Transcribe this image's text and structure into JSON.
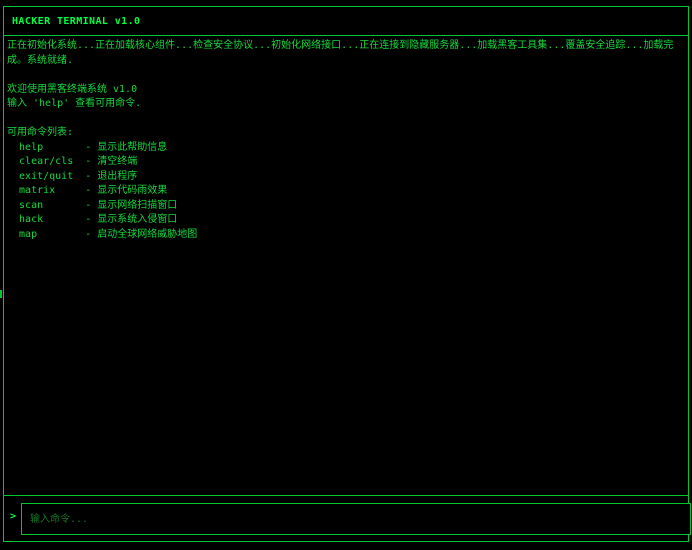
{
  "app": {
    "title": "HACKER TERMINAL v1.0"
  },
  "terminal": {
    "boot_line": "正在初始化系统...正在加载核心组件...检查安全协议...初始化网络接口...正在连接到隐藏服务器...加载黑客工具集...覆盖安全追踪...加载完成。系统就绪.",
    "welcome": "欢迎使用黑客终端系统 v1.0",
    "hint": "输入 'help' 查看可用命令.",
    "commands_header": "可用命令列表:",
    "commands": [
      {
        "text": "  help       - 显示此帮助信息"
      },
      {
        "text": "  clear/cls  - 清空终端"
      },
      {
        "text": "  exit/quit  - 退出程序"
      },
      {
        "text": "  matrix     - 显示代码雨效果"
      },
      {
        "text": "  scan       - 显示网络扫描窗口"
      },
      {
        "text": "  hack       - 显示系统入侵窗口"
      },
      {
        "text": "  map        - 启动全球网络威胁地图"
      }
    ]
  },
  "input": {
    "prompt": ">",
    "placeholder": "输入命令..."
  }
}
